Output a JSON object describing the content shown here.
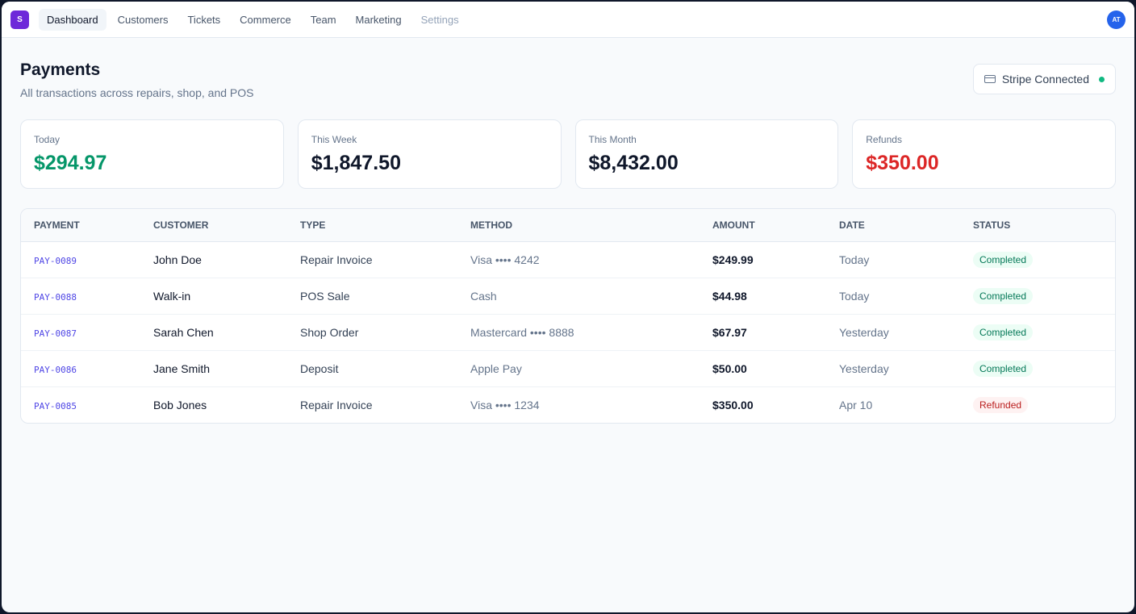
{
  "app": {
    "logo_letter": "S",
    "avatar_initials": "AT"
  },
  "nav": [
    {
      "label": "Dashboard",
      "state": "active"
    },
    {
      "label": "Customers",
      "state": "normal"
    },
    {
      "label": "Tickets",
      "state": "normal"
    },
    {
      "label": "Commerce",
      "state": "normal"
    },
    {
      "label": "Team",
      "state": "normal"
    },
    {
      "label": "Marketing",
      "state": "normal"
    },
    {
      "label": "Settings",
      "state": "muted"
    }
  ],
  "header": {
    "title": "Payments",
    "subtitle": "All transactions across repairs, shop, and POS",
    "stripe_label": "Stripe Connected",
    "stripe_status_color": "#10b981"
  },
  "stats": [
    {
      "label": "Today",
      "value": "$294.97",
      "tone": "green"
    },
    {
      "label": "This Week",
      "value": "$1,847.50",
      "tone": "default"
    },
    {
      "label": "This Month",
      "value": "$8,432.00",
      "tone": "default"
    },
    {
      "label": "Refunds",
      "value": "$350.00",
      "tone": "red"
    }
  ],
  "table": {
    "columns": [
      "PAYMENT",
      "CUSTOMER",
      "TYPE",
      "METHOD",
      "AMOUNT",
      "DATE",
      "STATUS"
    ],
    "rows": [
      {
        "id": "PAY-0089",
        "customer": "John Doe",
        "type": "Repair Invoice",
        "method": "Visa •••• 4242",
        "amount": "$249.99",
        "date": "Today",
        "status": "Completed"
      },
      {
        "id": "PAY-0088",
        "customer": "Walk-in",
        "type": "POS Sale",
        "method": "Cash",
        "amount": "$44.98",
        "date": "Today",
        "status": "Completed"
      },
      {
        "id": "PAY-0087",
        "customer": "Sarah Chen",
        "type": "Shop Order",
        "method": "Mastercard •••• 8888",
        "amount": "$67.97",
        "date": "Yesterday",
        "status": "Completed"
      },
      {
        "id": "PAY-0086",
        "customer": "Jane Smith",
        "type": "Deposit",
        "method": "Apple Pay",
        "amount": "$50.00",
        "date": "Yesterday",
        "status": "Completed"
      },
      {
        "id": "PAY-0085",
        "customer": "Bob Jones",
        "type": "Repair Invoice",
        "method": "Visa •••• 1234",
        "amount": "$350.00",
        "date": "Apr 10",
        "status": "Refunded"
      }
    ]
  },
  "colors": {
    "accent": "#6d28d9",
    "positive": "#059669",
    "negative": "#dc2626",
    "link": "#4f46e5"
  }
}
